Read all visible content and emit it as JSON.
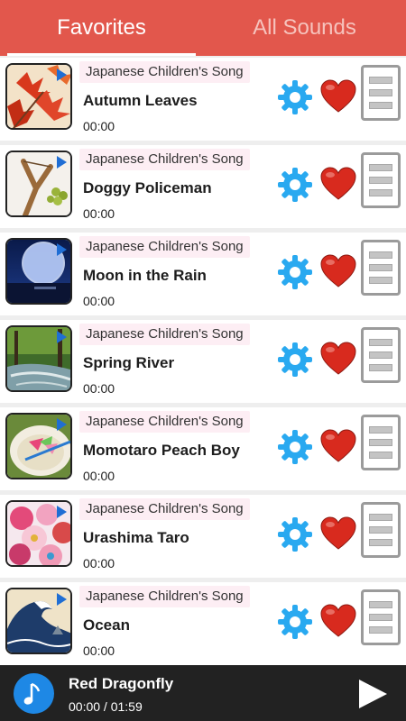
{
  "tabs": [
    {
      "label": "Favorites",
      "active": true
    },
    {
      "label": "All Sounds",
      "active": false
    }
  ],
  "songs": [
    {
      "tag": "Japanese Children's Song",
      "title": "Autumn Leaves",
      "time": "00:00",
      "thumb": "autumn-leaves-image"
    },
    {
      "tag": "Japanese Children's Song",
      "title": "Doggy Policeman",
      "time": "00:00",
      "thumb": "slingshot-image"
    },
    {
      "tag": "Japanese Children's Song",
      "title": "Moon in the Rain",
      "time": "00:00",
      "thumb": "moon-night-image"
    },
    {
      "tag": "Japanese Children's Song",
      "title": "Spring River",
      "time": "00:00",
      "thumb": "forest-river-image"
    },
    {
      "tag": "Japanese Children's Song",
      "title": "Momotaro Peach Boy",
      "time": "00:00",
      "thumb": "peach-dessert-image"
    },
    {
      "tag": "Japanese Children's Song",
      "title": "Urashima Taro",
      "time": "00:00",
      "thumb": "colorful-pouches-image"
    },
    {
      "tag": "Japanese Children's Song",
      "title": "Ocean",
      "time": "00:00",
      "thumb": "great-wave-image"
    }
  ],
  "player": {
    "title": "Red Dragonfly",
    "time": "00:00 / 01:59",
    "icon": "music-note-icon"
  },
  "colors": {
    "accent": "#e2574c",
    "player_bg": "#222222",
    "gear": "#29a9f0",
    "heart": "#d82a1e",
    "note_button": "#1e88e5"
  }
}
